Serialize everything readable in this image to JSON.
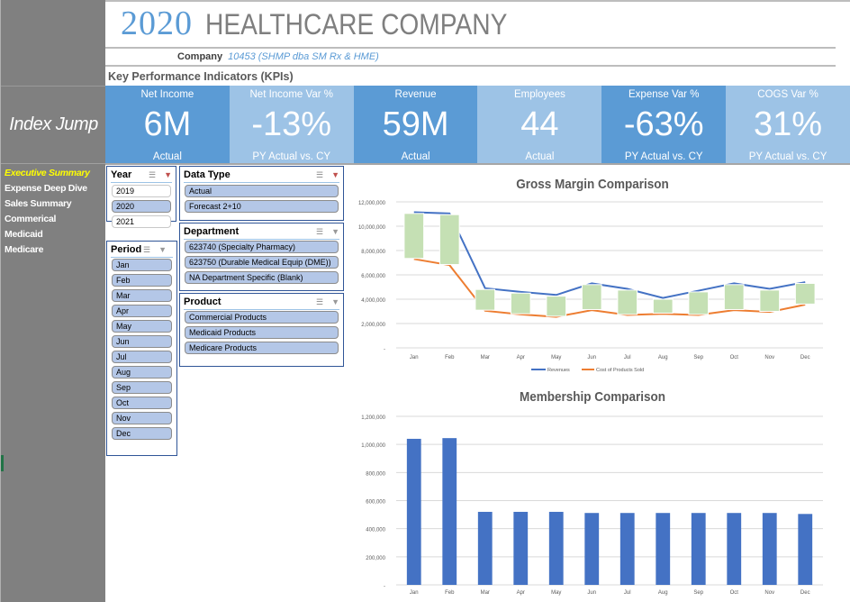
{
  "header": {
    "year": "2020",
    "company_name": "HEALTHCARE COMPANY",
    "company_label": "Company",
    "company_value": "10453 (SHMP dba SM Rx & HME)",
    "kpi_heading": "Key Performance Indicators (KPIs)"
  },
  "sidebar": {
    "index_jump": "Index Jump",
    "items": [
      {
        "label": "Executive Summary",
        "active": true
      },
      {
        "label": "Expense Deep Dive",
        "active": false
      },
      {
        "label": "Sales Summary",
        "active": false
      },
      {
        "label": "Commerical",
        "active": false
      },
      {
        "label": "Medicaid",
        "active": false
      },
      {
        "label": "Medicare",
        "active": false
      }
    ]
  },
  "kpis": [
    {
      "title": "Net Income",
      "value": "6M",
      "sub": "Actual",
      "tone": "dark"
    },
    {
      "title": "Net Income Var %",
      "value": "-13%",
      "sub": "PY Actual vs. CY",
      "tone": "light"
    },
    {
      "title": "Revenue",
      "value": "59M",
      "sub": "Actual",
      "tone": "dark"
    },
    {
      "title": "Employees",
      "value": "44",
      "sub": "Actual",
      "tone": "light"
    },
    {
      "title": "Expense Var %",
      "value": "-63%",
      "sub": "PY Actual vs. CY",
      "tone": "dark"
    },
    {
      "title": "COGS Var %",
      "value": "31%",
      "sub": "PY Actual vs. CY",
      "tone": "light"
    }
  ],
  "slicers": {
    "year": {
      "title": "Year",
      "items": [
        {
          "label": "2019",
          "selected": false
        },
        {
          "label": "2020",
          "selected": true
        },
        {
          "label": "2021",
          "selected": false
        }
      ]
    },
    "period": {
      "title": "Period",
      "items": [
        "Jan",
        "Feb",
        "Mar",
        "Apr",
        "May",
        "Jun",
        "Jul",
        "Aug",
        "Sep",
        "Oct",
        "Nov",
        "Dec"
      ]
    },
    "data_type": {
      "title": "Data Type",
      "items": [
        "Actual",
        "Forecast 2+10"
      ]
    },
    "department": {
      "title": "Department",
      "items": [
        "623740 (Specialty Pharmacy)",
        "623750 (Durable Medical Equip (DME))",
        "NA Department Specific (Blank)"
      ]
    },
    "product": {
      "title": "Product",
      "items": [
        "Commercial Products",
        "Medicaid Products",
        "Medicare Products"
      ]
    },
    "icons": {
      "multiselect": "multi-select-icon",
      "clear": "clear-filter-icon"
    }
  },
  "colors": {
    "kpi_dark": "#5b9bd5",
    "kpi_light": "#9dc3e6",
    "revenue_line": "#4472c4",
    "cogs_line": "#ed7d31",
    "margin_box": "#c5e0b4",
    "bar": "#4472c4",
    "nav_active": "#ffff00"
  },
  "chart_data": [
    {
      "type": "line",
      "title": "Gross Margin Comparison",
      "categories": [
        "Jan",
        "Feb",
        "Mar",
        "Apr",
        "May",
        "Jun",
        "Jul",
        "Aug",
        "Sep",
        "Oct",
        "Nov",
        "Dec"
      ],
      "series": [
        {
          "name": "Revenues",
          "values": [
            11150000,
            11050000,
            4900000,
            4600000,
            4350000,
            5300000,
            4850000,
            4100000,
            4700000,
            5300000,
            4850000,
            5400000
          ]
        },
        {
          "name": "Cost of Products Sold",
          "values": [
            7300000,
            6800000,
            3050000,
            2750000,
            2550000,
            3100000,
            2700000,
            2800000,
            2700000,
            3100000,
            2950000,
            3550000
          ]
        }
      ],
      "margin_boxes": "green up-bars between Revenues and Cost of Products Sold",
      "yticks": [
        "-",
        "2,000,000",
        "4,000,000",
        "6,000,000",
        "8,000,000",
        "10,000,000",
        "12,000,000"
      ],
      "ylim": [
        0,
        12000000
      ],
      "xlabel": "",
      "ylabel": "",
      "grid": true,
      "legend": "bottom"
    },
    {
      "type": "bar",
      "title": "Membership Comparison",
      "categories": [
        "Jan",
        "Feb",
        "Mar",
        "Apr",
        "May",
        "Jun",
        "Jul",
        "Aug",
        "Sep",
        "Oct",
        "Nov",
        "Dec"
      ],
      "values": [
        1040000,
        1045000,
        520000,
        520000,
        520000,
        512000,
        512000,
        512000,
        512000,
        512000,
        512000,
        505000
      ],
      "yticks": [
        "-",
        "200,000",
        "400,000",
        "600,000",
        "800,000",
        "1,000,000",
        "1,200,000"
      ],
      "ylim": [
        0,
        1200000
      ],
      "xlabel": "",
      "ylabel": "",
      "grid": true,
      "legend": "none"
    }
  ]
}
